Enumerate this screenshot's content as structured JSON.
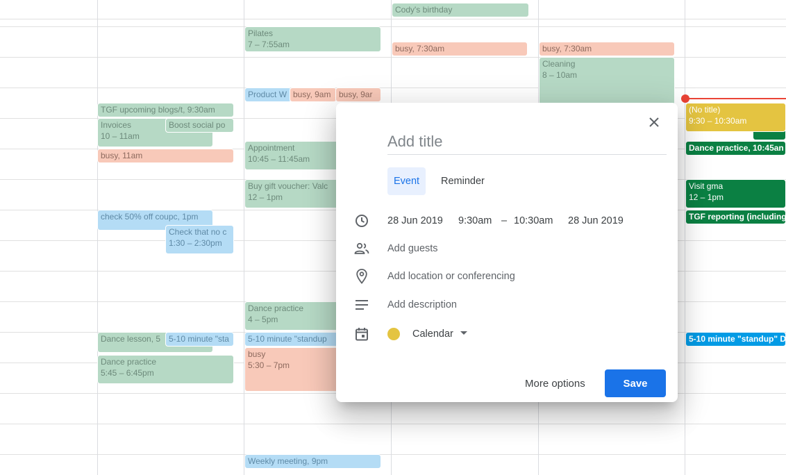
{
  "events": {
    "codys_birthday": {
      "title": "Cody's birthday"
    },
    "pilates": {
      "title": "Pilates",
      "time": "7 – 7:55am"
    },
    "busy_thu": {
      "title": "busy",
      "time": ", 7:30am"
    },
    "busy_fri": {
      "title": "busy",
      "time": ", 7:30am"
    },
    "cleaning": {
      "title": "Cleaning",
      "time": "8 – 10am"
    },
    "product_w": {
      "title": "Product W"
    },
    "busy_9am_a": {
      "title": "busy",
      "time": ", 9am"
    },
    "busy_9am_b": {
      "title": "busy",
      "time": ", 9ar"
    },
    "tgf_upcoming": {
      "title": "TGF upcoming blogs/t",
      "time": ", 9:30am"
    },
    "invoices": {
      "title": "Invoices",
      "time": "10 – 11am"
    },
    "boost_social": {
      "title": "Boost social po"
    },
    "busy_11am": {
      "title": "busy",
      "time": ", 11am"
    },
    "appointment": {
      "title": "Appointment",
      "time": "10:45 – 11:45am"
    },
    "buy_gift": {
      "title": "Buy gift voucher: Valc",
      "time": "12 – 1pm"
    },
    "check_50": {
      "title": "check 50% off coupc",
      "time": ", 1pm"
    },
    "check_no": {
      "title": "Check that no c",
      "time": "1:30 – 2:30pm"
    },
    "dance_practice_wed": {
      "title": "Dance practice",
      "time": "4 – 5pm"
    },
    "dance_lesson": {
      "title": "Dance lesson, 5"
    },
    "standup_tue": {
      "title": "5-10 minute \"sta"
    },
    "standup_wed": {
      "title": "5-10 minute \"standup"
    },
    "busy_wed": {
      "title": "busy",
      "time": "5:30 – 7pm"
    },
    "dance_practice_tue": {
      "title": "Dance practice",
      "time": "5:45 – 6:45pm"
    },
    "weekly_meeting": {
      "title": "Weekly meeting",
      "time": ", 9pm"
    },
    "no_title": {
      "title": "(No title)",
      "time": "9:30 – 10:30am"
    },
    "dance_practice_sat": {
      "title": "Dance practice",
      "time": ", 10:45an"
    },
    "visit_gma": {
      "title": "Visit gma",
      "time": "12 – 1pm"
    },
    "tgf_reporting": {
      "title": "TGF reporting (including"
    },
    "standup_sat": {
      "title": "5-10 minute \"standup\" D"
    }
  },
  "dialog": {
    "title_placeholder": "Add title",
    "tab_event": "Event",
    "tab_reminder": "Reminder",
    "start_date": "28 Jun 2019",
    "start_time": "9:30am",
    "dash": "–",
    "end_time": "10:30am",
    "end_date": "28 Jun 2019",
    "add_guests": "Add guests",
    "add_location": "Add location or conferencing",
    "add_description": "Add description",
    "calendar_label": "Calendar",
    "calendar_color": "#e4c441",
    "more_options": "More options",
    "save": "Save"
  },
  "icons": {
    "close": "close-icon",
    "time": "clock-icon",
    "guests": "people-icon",
    "location": "location-pin-icon",
    "description": "notes-icon",
    "calendar": "calendar-icon",
    "dropdown": "caret-down-icon"
  }
}
